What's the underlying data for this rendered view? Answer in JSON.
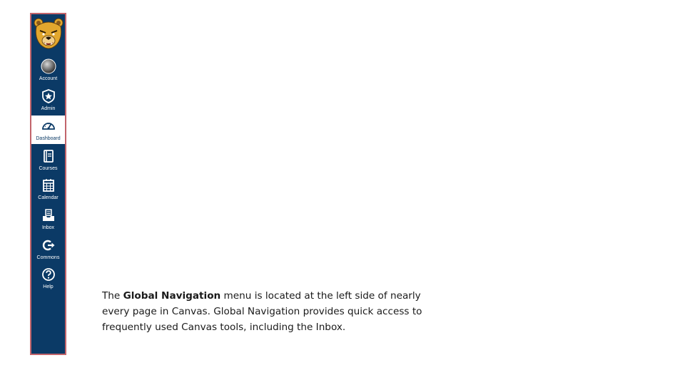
{
  "colors": {
    "nav_background": "#0b3a66",
    "nav_border": "#c2646b",
    "active_background": "#ffffff",
    "logo_gold": "#e2a72e"
  },
  "global_nav": {
    "logo_icon": "bear-logo-icon",
    "items": [
      {
        "label": "Account",
        "icon": "avatar-icon",
        "active": false
      },
      {
        "label": "Admin",
        "icon": "shield-star-icon",
        "active": false
      },
      {
        "label": "Dashboard",
        "icon": "speedometer-icon",
        "active": true
      },
      {
        "label": "Courses",
        "icon": "book-icon",
        "active": false
      },
      {
        "label": "Calendar",
        "icon": "calendar-icon",
        "active": false
      },
      {
        "label": "Inbox",
        "icon": "inbox-icon",
        "active": false
      },
      {
        "label": "Commons",
        "icon": "commons-icon",
        "active": false
      },
      {
        "label": "Help",
        "icon": "help-icon",
        "active": false
      }
    ]
  },
  "caption": {
    "part1": "The ",
    "bold": "Global Navigation",
    "part2": " menu is located at the left side of nearly every page in Canvas.  Global Navigation provides quick access to frequently used Canvas tools, including the Inbox."
  }
}
